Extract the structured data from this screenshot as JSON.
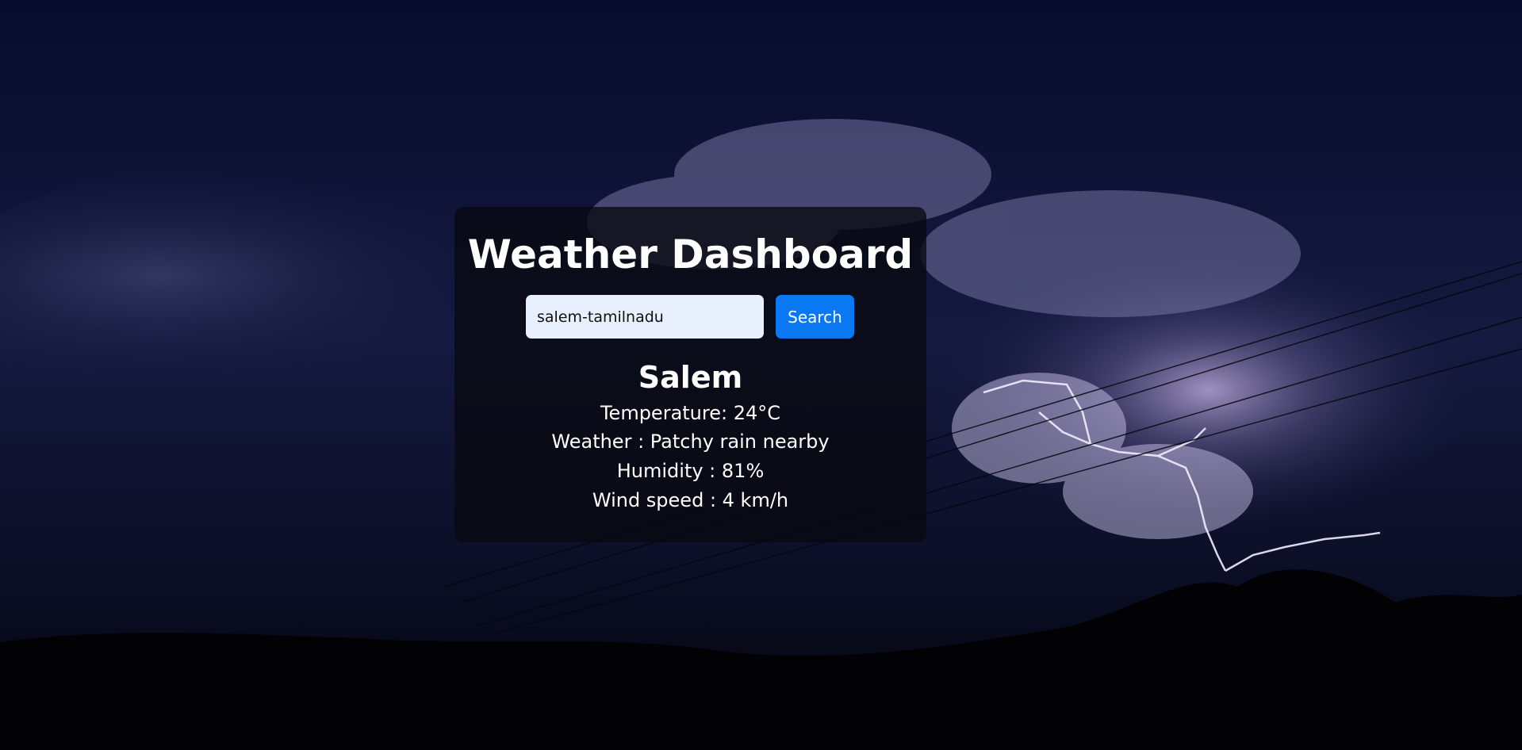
{
  "app": {
    "title": "Weather Dashboard"
  },
  "search": {
    "value": "salem-tamilnadu",
    "button_label": "Search"
  },
  "result": {
    "city": "Salem",
    "temperature": "Temperature: 24°C",
    "weather": "Weather : Patchy rain nearby",
    "humidity": "Humidity : 81%",
    "wind_speed": "Wind speed : 4 km/h"
  },
  "colors": {
    "button": "#0a78f2",
    "input_bg": "#e8effd",
    "card_bg": "#080910"
  }
}
